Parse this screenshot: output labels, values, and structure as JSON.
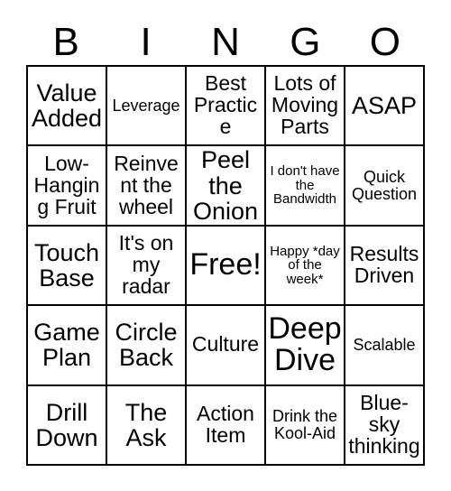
{
  "card": {
    "background_color": "#ffffff",
    "border_color": "#000000",
    "text_color": "#000000",
    "header_letters": [
      "B",
      "I",
      "N",
      "G",
      "O"
    ],
    "columns": 5,
    "rows": 5
  },
  "grid": {
    "rows": [
      {
        "cells": [
          {
            "text": "Value Added",
            "size": "lg"
          },
          {
            "text": "Leverage",
            "size": "sm"
          },
          {
            "text": "Best Practice",
            "size": "md"
          },
          {
            "text": "Lots of Moving Parts",
            "size": "md"
          },
          {
            "text": "ASAP",
            "size": "lg"
          }
        ]
      },
      {
        "cells": [
          {
            "text": "Low-Hanging Fruit",
            "size": "md"
          },
          {
            "text": "Reinvent the wheel",
            "size": "md"
          },
          {
            "text": "Peel the Onion",
            "size": "lg"
          },
          {
            "text": "I don't have the Bandwidth",
            "size": "xs"
          },
          {
            "text": "Quick Question",
            "size": "sm"
          }
        ]
      },
      {
        "cells": [
          {
            "text": "Touch Base",
            "size": "lg"
          },
          {
            "text": "It's on my radar",
            "size": "md"
          },
          {
            "text": "Free!",
            "size": "xl"
          },
          {
            "text": "Happy *day of the week*",
            "size": "xs"
          },
          {
            "text": "Results Driven",
            "size": "md"
          }
        ]
      },
      {
        "cells": [
          {
            "text": "Game Plan",
            "size": "lg"
          },
          {
            "text": "Circle Back",
            "size": "lg"
          },
          {
            "text": "Culture",
            "size": "md"
          },
          {
            "text": "Deep Dive",
            "size": "xl"
          },
          {
            "text": "Scalable",
            "size": "sm"
          }
        ]
      },
      {
        "cells": [
          {
            "text": "Drill Down",
            "size": "lg"
          },
          {
            "text": "The Ask",
            "size": "lg"
          },
          {
            "text": "Action Item",
            "size": "md"
          },
          {
            "text": "Drink the Kool-Aid",
            "size": "sm"
          },
          {
            "text": "Blue-sky thinking",
            "size": "md"
          }
        ]
      }
    ]
  }
}
